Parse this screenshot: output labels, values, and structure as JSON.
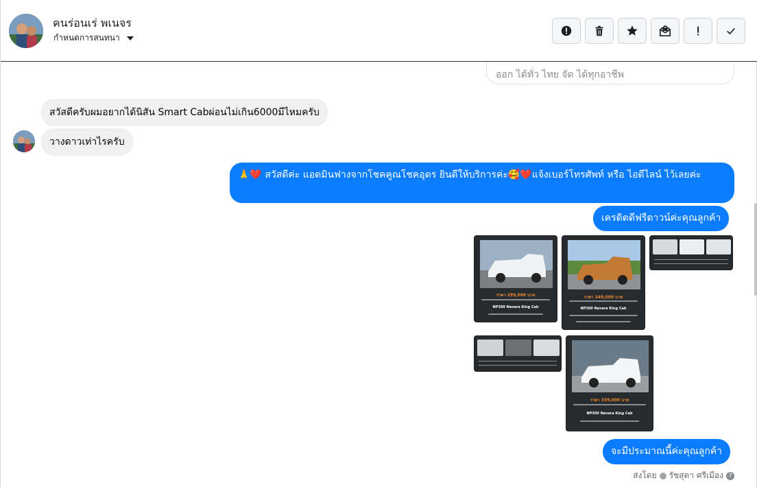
{
  "header": {
    "contact_name": "คนร่อนเร่ พเนจร",
    "assign_label": "กำหนดการสนทนา"
  },
  "toolbar": {
    "buttons": [
      {
        "icon": "alert-circle-icon"
      },
      {
        "icon": "trash-icon"
      },
      {
        "icon": "star-icon"
      },
      {
        "icon": "mail-open-icon"
      },
      {
        "icon": "exclamation-icon"
      },
      {
        "icon": "check-icon"
      }
    ]
  },
  "thread": {
    "previous_card_text": "ออก ได้ทั่ว ไทย จัด ได้ทุกอาชีพ",
    "messages": [
      {
        "from": "contact",
        "text": "สวัสดีครับผมอยากได้นิสัน Smart Cabผ่อนไม่เกิน6000มีไหมครับ"
      },
      {
        "from": "contact",
        "text": "วางดาวเท่าไรครับ"
      },
      {
        "from": "page",
        "text": "🙏❤️ สวัสดีค่ะ แอดมินฟางจากโชคคูณโชคอุดร ยินดีให้บริการค่ะ🥰❤️แจ้งเบอร์โทรศัพท์ หรือ ไอดีไลน์  ไว้เลยค่ะ"
      },
      {
        "from": "page",
        "text": "เครดิตดีฟรีดาวน์ค่ะคุณลูกค้า"
      },
      {
        "from": "page",
        "text": "จะมีประมาณนี้ค่ะคุณลูกค้า"
      }
    ],
    "images": [
      {
        "price": "ราคา 299,000 บาท",
        "model": "NP300 Navara King Cab",
        "photo_color": "#e9ecef"
      },
      {
        "price": "ราคา 349,000 บาท",
        "model": "NP300 Navara King Cab",
        "photo_color": "#c27a34"
      },
      {
        "price": "ราคา 339,000 บาท",
        "model": "NP300 Navara King Cab",
        "photo_color": "#dfe3e6"
      }
    ],
    "sent_by_label": "ส่งโดย",
    "sent_by_name": "รัชสุดา ศรีเมือง"
  },
  "colors": {
    "outgoing_bubble": "#0a7cff",
    "incoming_bubble": "#f0f0f0",
    "header_divider": "#2b2b2b"
  }
}
